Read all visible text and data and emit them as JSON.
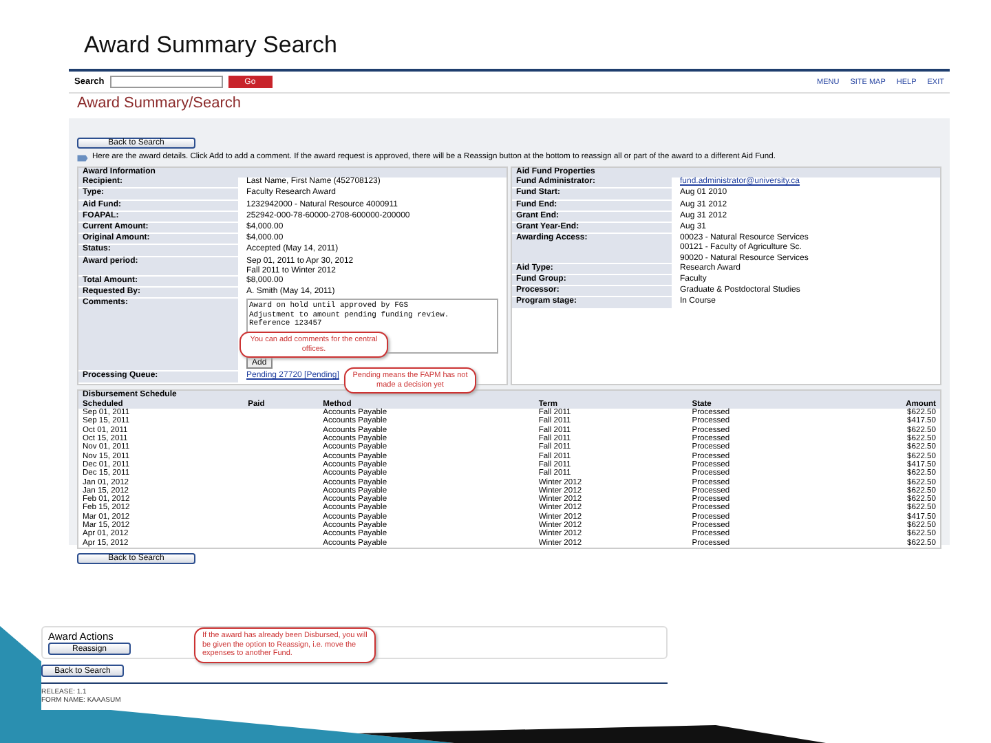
{
  "slide_title": "Award Summary Search",
  "header": {
    "search_label": "Search",
    "search_button": "Go",
    "links": [
      "MENU",
      "SITE MAP",
      "HELP",
      "EXIT"
    ],
    "page_title": "Award Summary/Search"
  },
  "back_button": "Back to Search",
  "panel_bottom_back_button": "Back to Search",
  "info_text": "Here are the award details. Click Add to add a comment. If the award request is approved, there will be a Reassign button at the bottom to reassign all or part of the award to a different Aid Fund.",
  "award_information": {
    "title": "Award Information",
    "fields": [
      {
        "kind": "text",
        "label": "Recipient:",
        "lines": [
          "Last Name, First Name (452708123)"
        ]
      },
      {
        "kind": "text",
        "label": "Type:",
        "lines": [
          "Faculty Research Award"
        ]
      },
      {
        "kind": "text",
        "label": "Aid Fund:",
        "lines": [
          "1232942000 - Natural Resource 4000911"
        ]
      },
      {
        "kind": "text",
        "label": "FOAPAL:",
        "lines": [
          "252942-000-78-60000-2708-600000-200000"
        ]
      },
      {
        "kind": "text",
        "label": "Current Amount:",
        "lines": [
          "$4,000.00"
        ]
      },
      {
        "kind": "text",
        "label": "Original Amount:",
        "lines": [
          "$4,000.00"
        ]
      },
      {
        "kind": "text",
        "label": "Status:",
        "lines": [
          "Accepted (May 14, 2011)"
        ]
      },
      {
        "kind": "text",
        "label": "Award period:",
        "lines": [
          "Sep 01, 2011 to Apr 30, 2012",
          "Fall 2011 to Winter 2012"
        ]
      },
      {
        "kind": "text",
        "label": "Total Amount:",
        "lines": [
          "$8,000.00"
        ]
      },
      {
        "kind": "text",
        "label": "Requested By:",
        "lines": [
          "A. Smith (May 14, 2011)"
        ]
      },
      {
        "kind": "comments",
        "label": "Comments:",
        "lines": [
          "Award on hold until approved by FGS",
          "Adjustment to amount pending funding review.",
          "Reference 123457"
        ],
        "button": "Add"
      },
      {
        "kind": "link",
        "label": "Processing Queue:",
        "lines": [
          "Pending 27720 [Pending]"
        ]
      }
    ]
  },
  "aid_fund_properties": {
    "title": "Aid Fund Properties",
    "fields": [
      {
        "kind": "link",
        "label": "Fund Administrator:",
        "lines": [
          "fund.administrator@university.ca"
        ]
      },
      {
        "kind": "text",
        "label": "Fund Start:",
        "lines": [
          "Aug 01 2010"
        ]
      },
      {
        "kind": "text",
        "label": "Fund End:",
        "lines": [
          "Aug 31 2012"
        ]
      },
      {
        "kind": "text",
        "label": "Grant End:",
        "lines": [
          "Aug 31 2012"
        ]
      },
      {
        "kind": "text",
        "label": "Grant Year-End:",
        "lines": [
          "Aug 31"
        ]
      },
      {
        "kind": "text",
        "label": "Awarding Access:",
        "lines": [
          "00023 - Natural Resource Services",
          "00121 - Faculty of Agriculture Sc.",
          "90020 - Natural Resource Services"
        ]
      },
      {
        "kind": "text",
        "label": "Aid Type:",
        "lines": [
          "Research Award"
        ]
      },
      {
        "kind": "text",
        "label": "Fund Group:",
        "lines": [
          "Faculty"
        ]
      },
      {
        "kind": "text",
        "label": "Processor:",
        "lines": [
          "Graduate & Postdoctoral Studies"
        ]
      },
      {
        "kind": "text",
        "label": "Program stage:",
        "lines": [
          "In Course"
        ]
      }
    ]
  },
  "callouts": [
    "You can add comments for the central offices.",
    "Pending means the FAPM has not made a decision yet"
  ],
  "disbursement_schedule": {
    "title": "Disbursement Schedule",
    "columns": [
      "Scheduled",
      "Paid",
      "Method",
      "Term",
      "State",
      "Amount"
    ],
    "rows": [
      [
        "Sep 01, 2011",
        "",
        "Accounts Payable",
        "Fall 2011",
        "Processed",
        "$622.50"
      ],
      [
        "Sep 15, 2011",
        "",
        "Accounts Payable",
        "Fall 2011",
        "Processed",
        "$417.50"
      ],
      [
        "Oct 01, 2011",
        "",
        "Accounts Payable",
        "Fall 2011",
        "Processed",
        "$622.50"
      ],
      [
        "Oct 15, 2011",
        "",
        "Accounts Payable",
        "Fall 2011",
        "Processed",
        "$622.50"
      ],
      [
        "Nov 01, 2011",
        "",
        "Accounts Payable",
        "Fall 2011",
        "Processed",
        "$622.50"
      ],
      [
        "Nov 15, 2011",
        "",
        "Accounts Payable",
        "Fall 2011",
        "Processed",
        "$622.50"
      ],
      [
        "Dec 01, 2011",
        "",
        "Accounts Payable",
        "Fall 2011",
        "Processed",
        "$417.50"
      ],
      [
        "Dec 15, 2011",
        "",
        "Accounts Payable",
        "Fall 2011",
        "Processed",
        "$622.50"
      ],
      [
        "Jan 01, 2012",
        "",
        "Accounts Payable",
        "Winter 2012",
        "Processed",
        "$622.50"
      ],
      [
        "Jan 15, 2012",
        "",
        "Accounts Payable",
        "Winter 2012",
        "Processed",
        "$622.50"
      ],
      [
        "Feb 01, 2012",
        "",
        "Accounts Payable",
        "Winter 2012",
        "Processed",
        "$622.50"
      ],
      [
        "Feb 15, 2012",
        "",
        "Accounts Payable",
        "Winter 2012",
        "Processed",
        "$622.50"
      ],
      [
        "Mar 01, 2012",
        "",
        "Accounts Payable",
        "Winter 2012",
        "Processed",
        "$417.50"
      ],
      [
        "Mar 15, 2012",
        "",
        "Accounts Payable",
        "Winter 2012",
        "Processed",
        "$622.50"
      ],
      [
        "Apr 01, 2012",
        "",
        "Accounts Payable",
        "Winter 2012",
        "Processed",
        "$622.50"
      ],
      [
        "Apr 15, 2012",
        "",
        "Accounts Payable",
        "Winter 2012",
        "Processed",
        "$622.50"
      ]
    ]
  },
  "award_actions": {
    "title": "Award Actions",
    "button": "Reassign",
    "callout": "If the award has already been Disbursed, you will be given the option to Reassign, i.e. move the expenses to another Fund."
  },
  "bottom_back_button": "Back to Search",
  "footer": [
    "RELEASE: 1.1",
    "FORM NAME: KAAASUM"
  ]
}
